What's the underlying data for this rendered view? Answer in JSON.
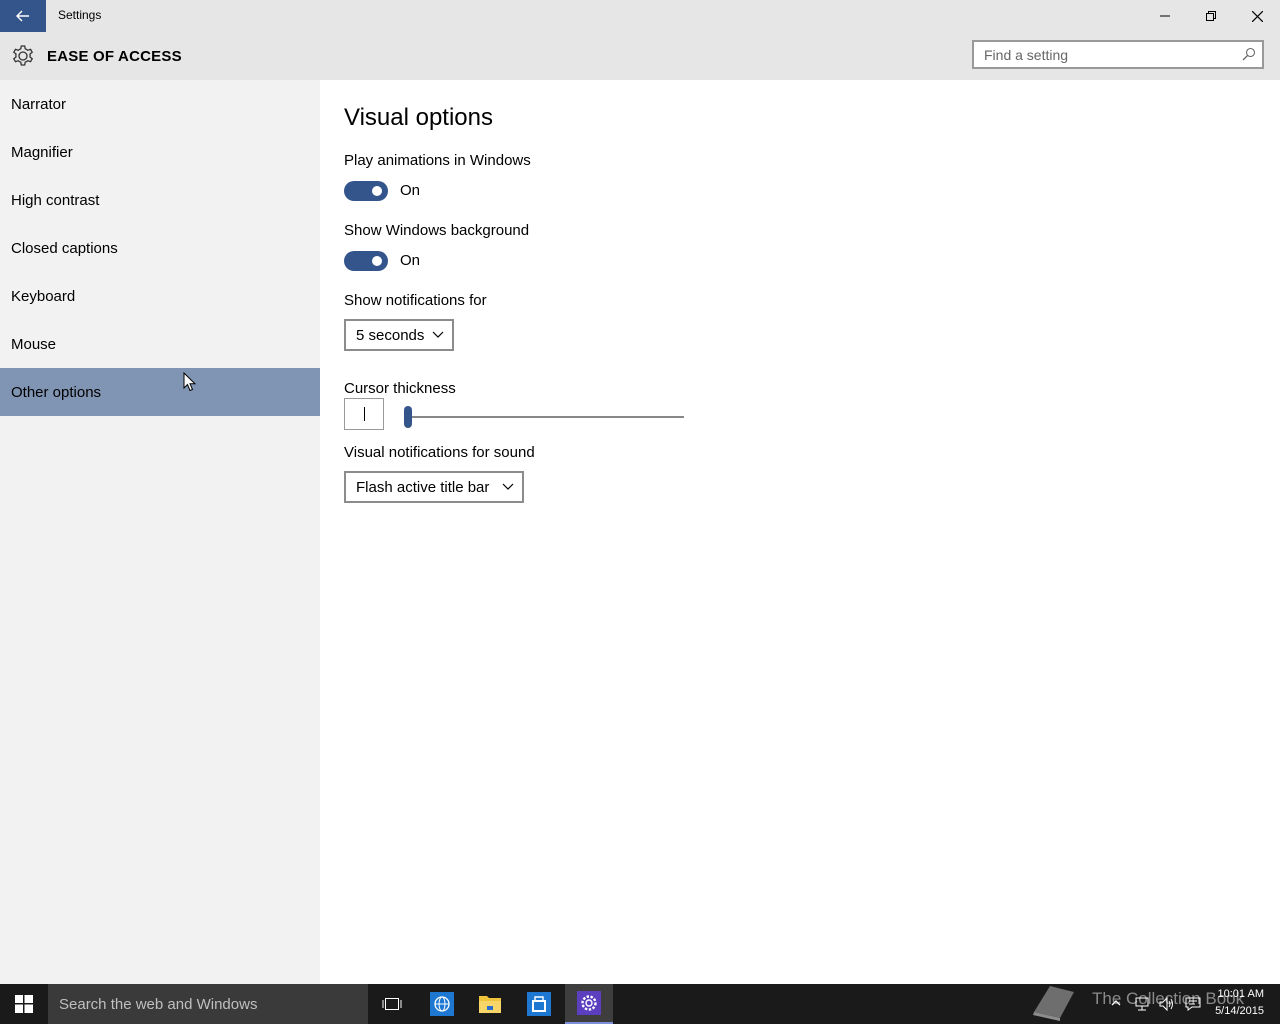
{
  "window": {
    "title": "Settings",
    "controls": {
      "minimize": "minimize-icon",
      "restore": "restore-icon",
      "close": "close-icon"
    }
  },
  "header": {
    "heading": "EASE OF ACCESS",
    "search": {
      "placeholder": "Find a setting",
      "value": ""
    }
  },
  "sidebar": {
    "items": [
      {
        "label": "Narrator",
        "selected": false
      },
      {
        "label": "Magnifier",
        "selected": false
      },
      {
        "label": "High contrast",
        "selected": false
      },
      {
        "label": "Closed captions",
        "selected": false
      },
      {
        "label": "Keyboard",
        "selected": false
      },
      {
        "label": "Mouse",
        "selected": false
      },
      {
        "label": "Other options",
        "selected": true
      }
    ]
  },
  "main": {
    "title": "Visual options",
    "play_animations": {
      "label": "Play animations in Windows",
      "state": "On"
    },
    "show_background": {
      "label": "Show Windows background",
      "state": "On"
    },
    "notifications": {
      "label": "Show notifications for",
      "value": "5 seconds"
    },
    "cursor_thickness": {
      "label": "Cursor thickness",
      "level": 0
    },
    "visual_notifications": {
      "label": "Visual notifications for sound",
      "value": "Flash active title bar"
    }
  },
  "taskbar": {
    "search_text": "Search the web and Windows",
    "watermark": "The Collection Book",
    "time": "10:01 AM",
    "date": "5/14/2015"
  },
  "colors": {
    "accent": "#34558b",
    "selected_nav": "#8094b4",
    "sidebar_bg": "#f2f2f2",
    "titlebar_bg": "#e6e6e6",
    "taskbar_bg": "#1a1a1a"
  }
}
